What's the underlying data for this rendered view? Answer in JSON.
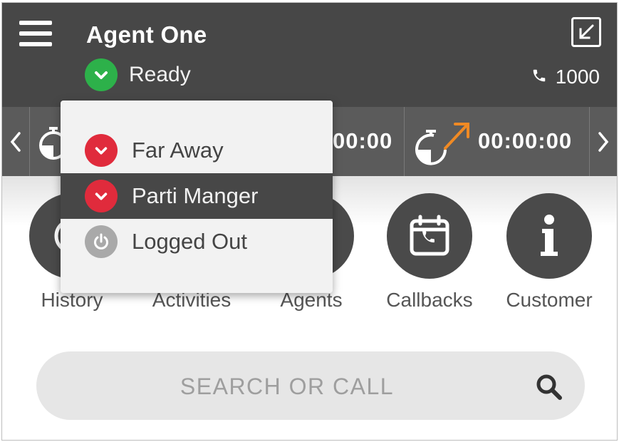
{
  "header": {
    "agent_name": "Agent One",
    "status": "Ready",
    "extension": "1000"
  },
  "timers": {
    "timer1_value": "00:00",
    "timer2_value": "00:00:00"
  },
  "tiles": [
    {
      "label": "History",
      "icon": "history-icon"
    },
    {
      "label": "Activities",
      "icon": "activities-icon"
    },
    {
      "label": "Agents",
      "icon": "agents-icon"
    },
    {
      "label": "Callbacks",
      "icon": "calendar-phone-icon"
    },
    {
      "label": "Customer",
      "icon": "info-icon"
    }
  ],
  "search": {
    "placeholder": "SEARCH OR CALL"
  },
  "status_menu": {
    "items": [
      {
        "label": "Far Away",
        "icon": "chevron-down-icon"
      },
      {
        "label": "Parti Manger",
        "icon": "chevron-down-icon"
      },
      {
        "label": "Logged Out",
        "icon": "power-icon"
      }
    ]
  },
  "colors": {
    "header_bg": "#474747",
    "ready_green": "#2db14a",
    "away_red": "#e02b3c",
    "logged_out_grey": "#a9a9a9",
    "timer_accent": "#f08a24"
  }
}
